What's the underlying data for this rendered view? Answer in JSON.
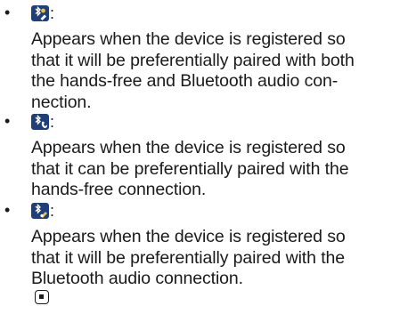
{
  "entries": [
    {
      "bullet": "•",
      "icon": "bluetooth-handsfree-audio-icon",
      "colon": ":",
      "lines": [
        "Appears when the device is registered so",
        "that it will be preferentially paired with both",
        "the hands-free and Bluetooth audio con-",
        "nection."
      ]
    },
    {
      "bullet": "•",
      "icon": "bluetooth-handsfree-icon",
      "colon": ":",
      "lines": [
        "Appears when the device is registered so",
        "that it can be preferentially paired with the",
        "hands-free connection."
      ]
    },
    {
      "bullet": "•",
      "icon": "bluetooth-audio-icon",
      "colon": ":",
      "lines": [
        "Appears when the device is registered so",
        "that it will be preferentially paired with the",
        "Bluetooth audio connection."
      ],
      "end_mark_icon": "end-of-section-icon"
    }
  ],
  "colors": {
    "icon_bg": "#1f3f7a",
    "text": "#1a1a1a"
  }
}
